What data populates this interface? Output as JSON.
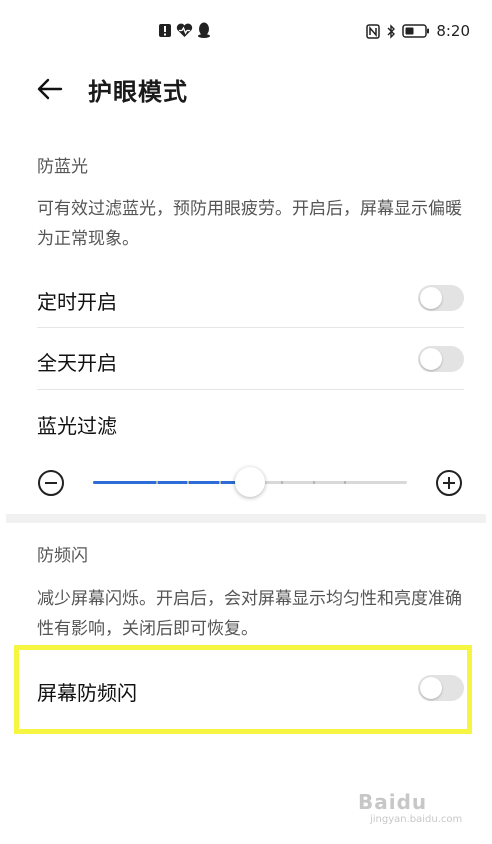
{
  "status_bar": {
    "time": "8:20",
    "left_icons": [
      "notification-alert-icon",
      "health-heart-icon",
      "qq-penguin-icon"
    ],
    "right_icons": [
      "nfc-icon",
      "bluetooth-icon",
      "battery-icon"
    ]
  },
  "header": {
    "title": "护眼模式"
  },
  "blue_light": {
    "section_title": "防蓝光",
    "description": "可有效过滤蓝光，预防用眼疲劳。开启后，屏幕显示偏暖为正常现象。",
    "scheduled": {
      "label": "定时开启",
      "enabled": false
    },
    "all_day": {
      "label": "全天开启",
      "enabled": false
    },
    "filter": {
      "label": "蓝光过滤",
      "level": 0.5
    }
  },
  "flicker": {
    "section_title": "防频闪",
    "description": "减少屏幕闪烁。开启后，会对屏幕显示均匀性和亮度准确性有影响，关闭后即可恢复。",
    "screen_flicker": {
      "label": "屏幕防频闪",
      "enabled": false
    }
  },
  "colors": {
    "accent": "#2d6bd6",
    "highlight": "#f5f542",
    "switch_off": "#e3e3e3"
  },
  "watermark": {
    "text": "Baidu",
    "sub": "jingyan.baidu.com"
  }
}
